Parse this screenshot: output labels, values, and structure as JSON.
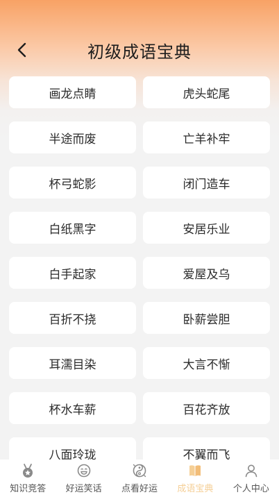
{
  "header": {
    "title": "初级成语宝典",
    "back_icon": "chevron-left-icon"
  },
  "idioms": [
    "画龙点睛",
    "虎头蛇尾",
    "半途而废",
    "亡羊补牢",
    "杯弓蛇影",
    "闭门造车",
    "白纸黑字",
    "安居乐业",
    "白手起家",
    "爱屋及乌",
    "百折不挠",
    "卧薪尝胆",
    "耳濡目染",
    "大言不惭",
    "杯水车薪",
    "百花齐放",
    "八面玲珑",
    "不翼而飞"
  ],
  "tabbar": {
    "active_color": "#f5cf96",
    "tabs": [
      {
        "label": "知识竞答",
        "icon": "medal-icon"
      },
      {
        "label": "好运笑话",
        "icon": "smile-face-icon"
      },
      {
        "label": "点看好运",
        "icon": "fortune-icon"
      },
      {
        "label": "成语宝典",
        "icon": "book-icon",
        "active": true
      },
      {
        "label": "个人中心",
        "icon": "person-icon"
      }
    ]
  }
}
